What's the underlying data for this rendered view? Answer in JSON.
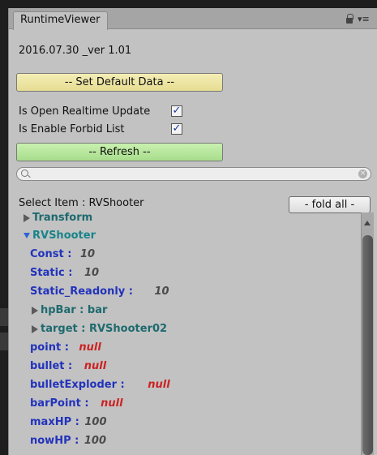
{
  "window": {
    "tab_title": "RuntimeViewer",
    "menu_glyph": "▾≡"
  },
  "info": {
    "version": "2016.07.30 _ver 1.01"
  },
  "actions": {
    "set_default_label": "-- Set Default Data --",
    "refresh_label": "-- Refresh --",
    "fold_all_label": "- fold all -"
  },
  "options": {
    "realtime_label": "Is Open Realtime Update",
    "realtime_checked": true,
    "forbid_label": "Is Enable Forbid List",
    "forbid_checked": true,
    "check_glyph": "✓"
  },
  "search": {
    "value": "",
    "clear_glyph": "×"
  },
  "selection": {
    "label": "Select Item : RVShooter"
  },
  "tree": {
    "transform": "Transform",
    "rvshooter": "RVShooter",
    "fields": [
      {
        "name": "Const :",
        "value": "10",
        "kind": "number"
      },
      {
        "name": "Static :",
        "value": "10",
        "kind": "number"
      },
      {
        "name": "Static_Readonly :",
        "value": "10",
        "kind": "number"
      },
      {
        "name": "hpBar : bar",
        "value": "",
        "kind": "child"
      },
      {
        "name": "target : RVShooter02",
        "value": "",
        "kind": "child"
      },
      {
        "name": "point :",
        "value": "null",
        "kind": "null"
      },
      {
        "name": "bullet :",
        "value": "null",
        "kind": "null"
      },
      {
        "name": "bulletExploder :",
        "value": "null",
        "kind": "null"
      },
      {
        "name": "barPoint :",
        "value": "null",
        "kind": "null"
      },
      {
        "name": "maxHP :",
        "value": "100",
        "kind": "number"
      },
      {
        "name": "nowHP :",
        "value": "100",
        "kind": "number"
      }
    ]
  }
}
